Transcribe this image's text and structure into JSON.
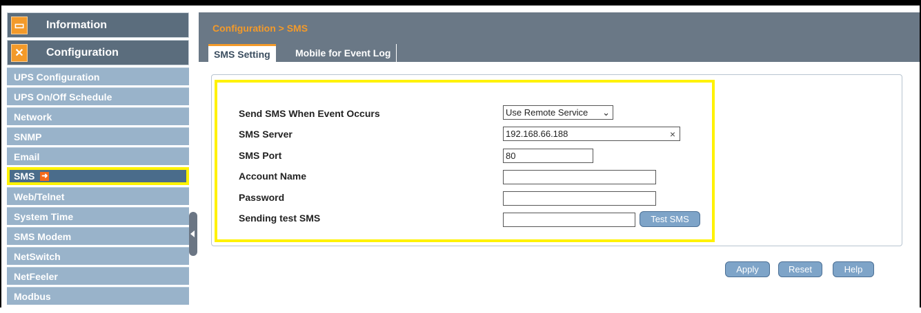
{
  "sidebar": {
    "information_label": "Information",
    "configuration_label": "Configuration",
    "items": [
      {
        "label": "UPS Configuration"
      },
      {
        "label": "UPS On/Off Schedule"
      },
      {
        "label": "Network"
      },
      {
        "label": "SNMP"
      },
      {
        "label": "Email"
      },
      {
        "label": "SMS"
      },
      {
        "label": "Web/Telnet"
      },
      {
        "label": "System Time"
      },
      {
        "label": "SMS Modem"
      },
      {
        "label": "NetSwitch"
      },
      {
        "label": "NetFeeler"
      },
      {
        "label": "Modbus"
      }
    ],
    "active_item": "SMS"
  },
  "header": {
    "breadcrumb": "Configuration > SMS",
    "tabs": [
      {
        "label": "SMS Setting",
        "active": true
      },
      {
        "label": "Mobile for Event Log",
        "active": false
      }
    ]
  },
  "form": {
    "send_sms_label": "Send SMS When Event Occurs",
    "send_sms_value": "Use Remote Service",
    "server_label": "SMS Server",
    "server_value": "192.168.66.188",
    "port_label": "SMS Port",
    "port_value": "80",
    "account_label": "Account Name",
    "account_value": "",
    "password_label": "Password",
    "password_value": "",
    "test_label": "Sending test SMS",
    "test_value": "",
    "test_button": "Test SMS"
  },
  "actions": {
    "apply": "Apply",
    "reset": "Reset",
    "help": "Help"
  },
  "colors": {
    "accent": "#f39a2a",
    "highlight": "#fff200",
    "sidebar_item": "#99b3ca",
    "header_bar": "#6a7886"
  }
}
